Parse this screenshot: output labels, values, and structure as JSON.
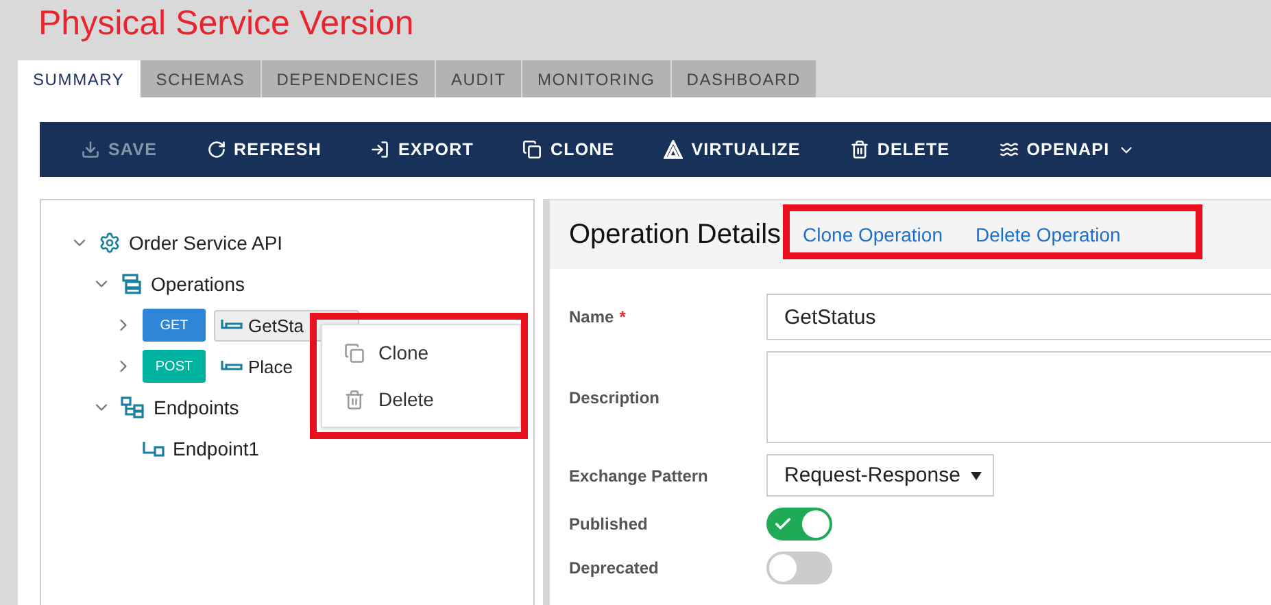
{
  "title": "Physical Service Version",
  "tabs": [
    {
      "label": "SUMMARY",
      "selected": true
    },
    {
      "label": "SCHEMAS",
      "selected": false
    },
    {
      "label": "DEPENDENCIES",
      "selected": false
    },
    {
      "label": "AUDIT",
      "selected": false
    },
    {
      "label": "MONITORING",
      "selected": false
    },
    {
      "label": "DASHBOARD",
      "selected": false
    }
  ],
  "toolbar": [
    {
      "label": "SAVE",
      "kind": "save",
      "disabled": true
    },
    {
      "label": "REFRESH",
      "kind": "refresh",
      "disabled": false
    },
    {
      "label": "EXPORT",
      "kind": "export",
      "disabled": false
    },
    {
      "label": "CLONE",
      "kind": "clone",
      "disabled": false
    },
    {
      "label": "VIRTUALIZE",
      "kind": "virtualize",
      "disabled": false
    },
    {
      "label": "DELETE",
      "kind": "delete",
      "disabled": false
    },
    {
      "label": "OPENAPI",
      "kind": "openapi",
      "disabled": false
    }
  ],
  "tree": [
    {
      "label": "Order Service API",
      "kind": "service",
      "expanded": true,
      "children": [
        {
          "label": "Operations",
          "kind": "operations",
          "expanded": true,
          "children": [
            {
              "label": "GetSta",
              "kind": "operation",
              "method": "GET",
              "color": "#2f86d8",
              "expanded": false,
              "selected": true
            },
            {
              "label": "Place",
              "kind": "operation",
              "method": "POST",
              "color": "#00b2a0",
              "expanded": false,
              "selected": false
            }
          ]
        },
        {
          "label": "Endpoints",
          "kind": "endpoints",
          "expanded": true,
          "children": [
            {
              "label": "Endpoint1",
              "kind": "endpoint"
            }
          ]
        }
      ]
    }
  ],
  "context_menu": [
    {
      "label": "Clone",
      "kind": "clone"
    },
    {
      "label": "Delete",
      "kind": "delete"
    }
  ],
  "details": {
    "title": "Operation Details",
    "actions": [
      "Clone Operation",
      "Delete Operation"
    ],
    "fields": [
      {
        "label": "Name",
        "required_mark": "*",
        "kind": "text",
        "value": "GetStatus"
      },
      {
        "label": "Description",
        "kind": "textarea"
      },
      {
        "label": "Exchange Pattern",
        "kind": "select",
        "value": "Request-Response"
      },
      {
        "label": "Published",
        "kind": "toggle",
        "on": true
      },
      {
        "label": "Deprecated",
        "kind": "toggle",
        "on": false
      }
    ]
  }
}
